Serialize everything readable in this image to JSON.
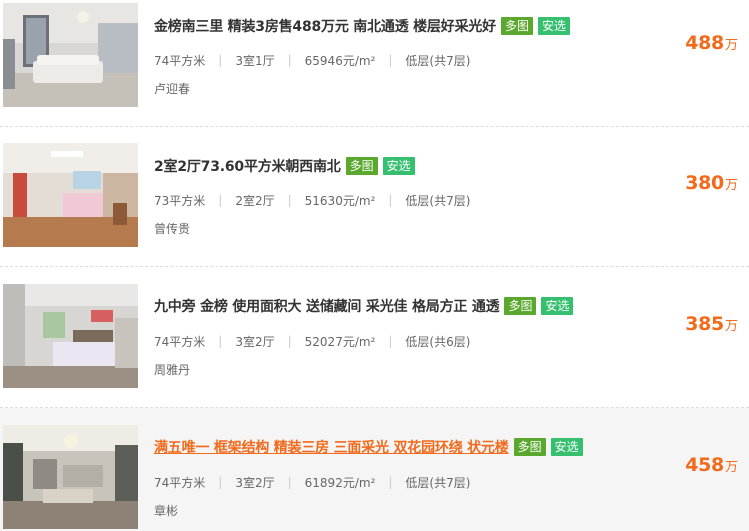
{
  "listings": [
    {
      "title": "金榜南三里 精装3房售488万元 南北通透 楼层好采光好",
      "tag_more": "多图",
      "tag_safe": "安选",
      "area": "74平方米",
      "layout": "3室1厅",
      "unit_price": "65946元/m²",
      "floor": "低层(共7层)",
      "agent": "卢迎春",
      "price": "488",
      "price_unit": "万"
    },
    {
      "title": "2室2厅73.60平方米朝西南北",
      "tag_more": "多图",
      "tag_safe": "安选",
      "area": "73平方米",
      "layout": "2室2厅",
      "unit_price": "51630元/m²",
      "floor": "低层(共7层)",
      "agent": "曾传贵",
      "price": "380",
      "price_unit": "万"
    },
    {
      "title": "九中旁 金榜 使用面积大 送储藏间 采光佳 格局方正 通透",
      "tag_more": "多图",
      "tag_safe": "安选",
      "area": "74平方米",
      "layout": "3室2厅",
      "unit_price": "52027元/m²",
      "floor": "低层(共6层)",
      "agent": "周雅丹",
      "price": "385",
      "price_unit": "万"
    },
    {
      "title": "满五唯一 框架结构 精装三房 三面采光 双花园环绕 状元楼",
      "tag_more": "多图",
      "tag_safe": "安选",
      "area": "74平方米",
      "layout": "3室2厅",
      "unit_price": "61892元/m²",
      "floor": "低层(共7层)",
      "agent": "章彬",
      "price": "458",
      "price_unit": "万"
    }
  ],
  "colors": {
    "price": "#f26a1b",
    "tag_more": "#5ba82e",
    "tag_safe": "#35bf6f"
  }
}
